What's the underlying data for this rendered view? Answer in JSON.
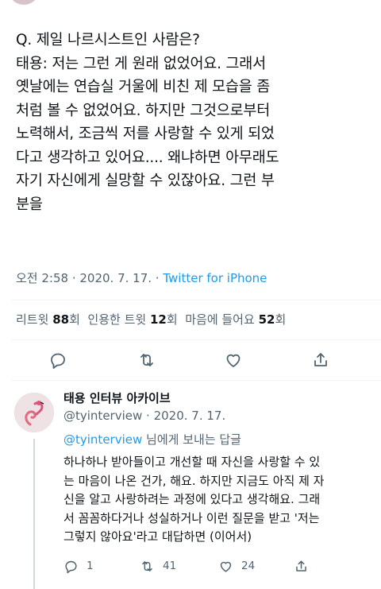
{
  "tweet": {
    "lines": [
      "Q. 제일 나르시스트인 사람은?",
      "태용: 저는 그런 게 원래 없었어요. 그래서",
      "옛날에는 연습실 거울에 비친 제 모습을 좀",
      "처럼 볼 수 없었어요. 하지만 그것으로부터",
      "노력해서, 조금씩 저를 사랑할 수 있게 되었",
      "다고 생각하고 있어요.... 왜냐하면 아무래도",
      "자기 자신에게 실망할 수 있잖아요. 그런 부",
      "분을"
    ],
    "time": "오전 2:58",
    "dot": " · ",
    "date": "2020. 7. 17.",
    "dot2": " · ",
    "source": "Twitter for iPhone"
  },
  "stats": {
    "retweets_label": "리트윗",
    "retweets_count": "88",
    "retweets_unit": "회",
    "quotes_label": "인용한 트윗",
    "quotes_count": "12",
    "quotes_unit": "회",
    "likes_label": "마음에 들어요",
    "likes_count": "52",
    "likes_unit": "회"
  },
  "actions": {
    "icons": [
      "reply-icon",
      "retweet-icon",
      "like-icon",
      "share-icon"
    ],
    "color": "#536471"
  },
  "reply": {
    "name": "태용 인터뷰 아카이브",
    "handle": "@tyinterview",
    "dot": " · ",
    "date": "2020. 7. 17.",
    "replying_handle": "@tyinterview",
    "replying_suffix": " 님에게 보내는 답글",
    "lines": [
      "하나하나 받아들이고 개선할 때 자신을 사랑할 수 있",
      "는 마음이 나온 건가, 해요. 하지만 지금도 아직 제 자",
      "신을 알고 사랑하려는 과정에 있다고 생각해요. 그래",
      "서 꼼꼼하다거나 성실하거나 이런 질문을 받고 '저는",
      "그렇지 않아요'라고 대답하면 (이어서)"
    ],
    "reply_count": "1",
    "retweet_count": "41",
    "like_count": "24"
  },
  "colors": {
    "link": "#1d9bf0",
    "secondary": "#536471",
    "text": "#0f1419",
    "divider": "#eff3f4"
  }
}
